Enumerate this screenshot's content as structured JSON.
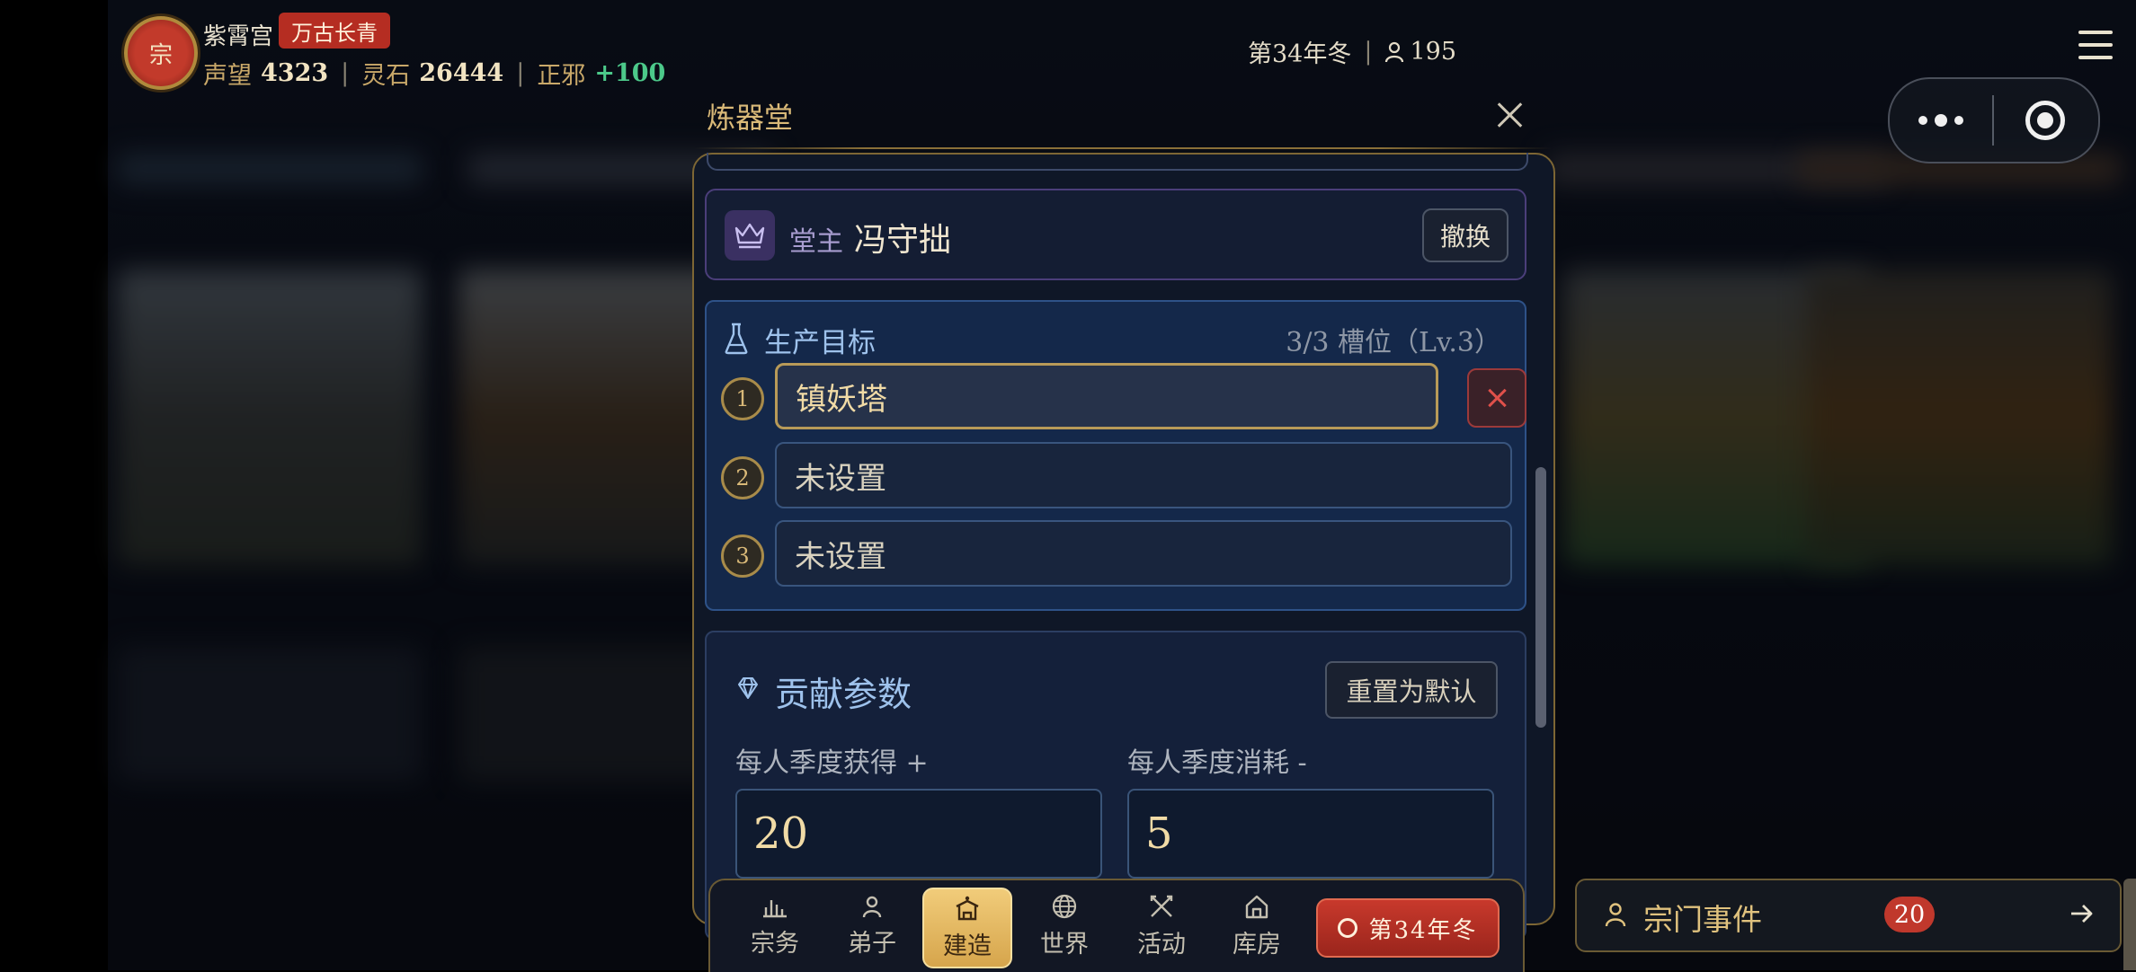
{
  "topbar": {
    "seal_char": "宗",
    "sect_name": "紫霄宫",
    "sect_badge": "万古长青",
    "stats": [
      {
        "label": "声望",
        "value": "4323"
      },
      {
        "label": "灵石",
        "value": "26444"
      },
      {
        "label": "正邪",
        "value": "+100"
      }
    ],
    "season": "第34年冬",
    "population": "195"
  },
  "dialog": {
    "title": "炼器堂",
    "master": {
      "role": "堂主",
      "name": "冯守拙",
      "swap_label": "撤换"
    },
    "production": {
      "title": "生产目标",
      "slots_info": "3/3 槽位（Lv.3）",
      "slots": [
        {
          "num": "1",
          "value": "镇妖塔"
        },
        {
          "num": "2",
          "value": "未设置"
        },
        {
          "num": "3",
          "value": "未设置"
        }
      ]
    },
    "contribution": {
      "title": "贡献参数",
      "reset_label": "重置为默认",
      "gain_label": "每人季度获得 +",
      "gain_value": "20",
      "cost_label": "每人季度消耗 -",
      "cost_value": "5"
    }
  },
  "nav": {
    "items": [
      {
        "label": "宗务",
        "icon": "chart-icon"
      },
      {
        "label": "弟子",
        "icon": "person-icon"
      },
      {
        "label": "建造",
        "icon": "building-icon"
      },
      {
        "label": "世界",
        "icon": "globe-icon"
      },
      {
        "label": "活动",
        "icon": "swords-icon"
      },
      {
        "label": "库房",
        "icon": "house-icon"
      }
    ],
    "next_season": "第34年冬"
  },
  "events": {
    "label": "宗门事件",
    "count": "20"
  },
  "colors": {
    "accent_gold": "#d9b978",
    "badge_red": "#b52d22",
    "positive_green": "#4cc98a",
    "panel_blue": "#14284a"
  }
}
